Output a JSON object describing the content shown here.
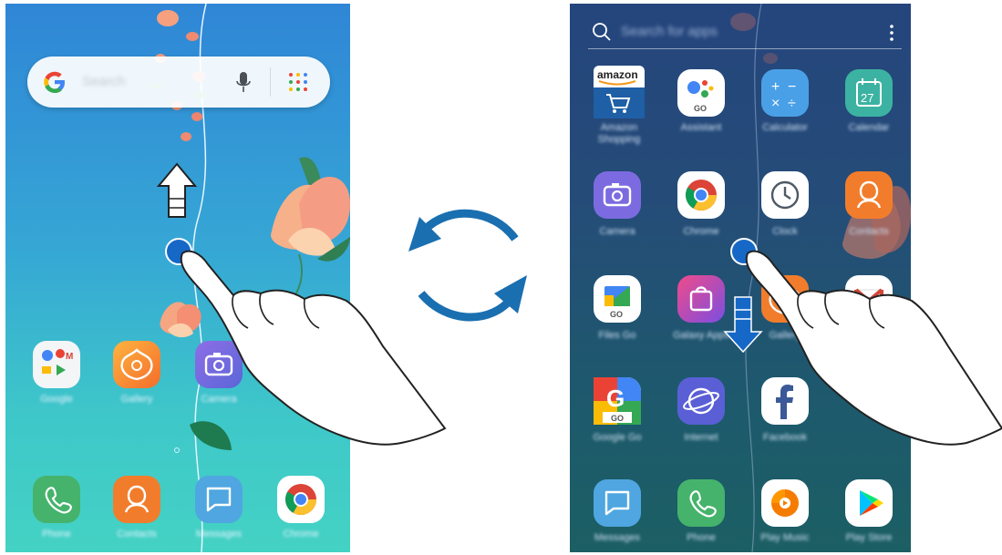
{
  "home": {
    "search_placeholder": "Search",
    "dock_apps": [
      {
        "label": "Phone",
        "icon": "phone-icon"
      },
      {
        "label": "Contacts",
        "icon": "contacts-icon"
      },
      {
        "label": "Messages",
        "icon": "messages-icon"
      },
      {
        "label": "Chrome",
        "icon": "chrome-icon"
      }
    ],
    "row_apps": [
      {
        "label": "Google",
        "icon": "google-folder-icon"
      },
      {
        "label": "Gallery",
        "icon": "gallery-icon"
      },
      {
        "label": "Camera",
        "icon": "camera-icon"
      }
    ],
    "gesture": "swipe-up"
  },
  "apps_screen": {
    "search_placeholder": "Search for apps",
    "amazon_label": "amazon",
    "calendar_date": "27",
    "assistant_badge": "GO",
    "files_badge": "GO",
    "google_badge": "GO",
    "gesture": "swipe-down",
    "apps": [
      {
        "label": "Amazon Shopping",
        "icon": "amazon-icon"
      },
      {
        "label": "Assistant",
        "icon": "assistant-icon"
      },
      {
        "label": "Calculator",
        "icon": "calculator-icon"
      },
      {
        "label": "Calendar",
        "icon": "calendar-icon"
      },
      {
        "label": "Camera",
        "icon": "camera-icon"
      },
      {
        "label": "Chrome",
        "icon": "chrome-icon"
      },
      {
        "label": "Clock",
        "icon": "clock-icon"
      },
      {
        "label": "Contacts",
        "icon": "contacts-icon"
      },
      {
        "label": "Files Go",
        "icon": "files-go-icon"
      },
      {
        "label": "Galaxy Apps",
        "icon": "galaxy-apps-icon"
      },
      {
        "label": "Gallery",
        "icon": "gallery-icon"
      },
      {
        "label": "Gmail",
        "icon": "gmail-icon"
      },
      {
        "label": "Google Go",
        "icon": "google-go-icon"
      },
      {
        "label": "Internet",
        "icon": "internet-icon"
      },
      {
        "label": "Facebook",
        "icon": "facebook-icon"
      },
      {
        "label": "Messages",
        "icon": "messages-icon"
      },
      {
        "label": "Phone",
        "icon": "phone-icon"
      },
      {
        "label": "Play Music",
        "icon": "play-music-icon"
      },
      {
        "label": "Play Store",
        "icon": "play-store-icon"
      }
    ]
  },
  "transition": {
    "icon": "switch-arrows-icon"
  },
  "colors": {
    "arrow_blue": "#1a6fb0",
    "touch_blue": "#1565c0"
  }
}
